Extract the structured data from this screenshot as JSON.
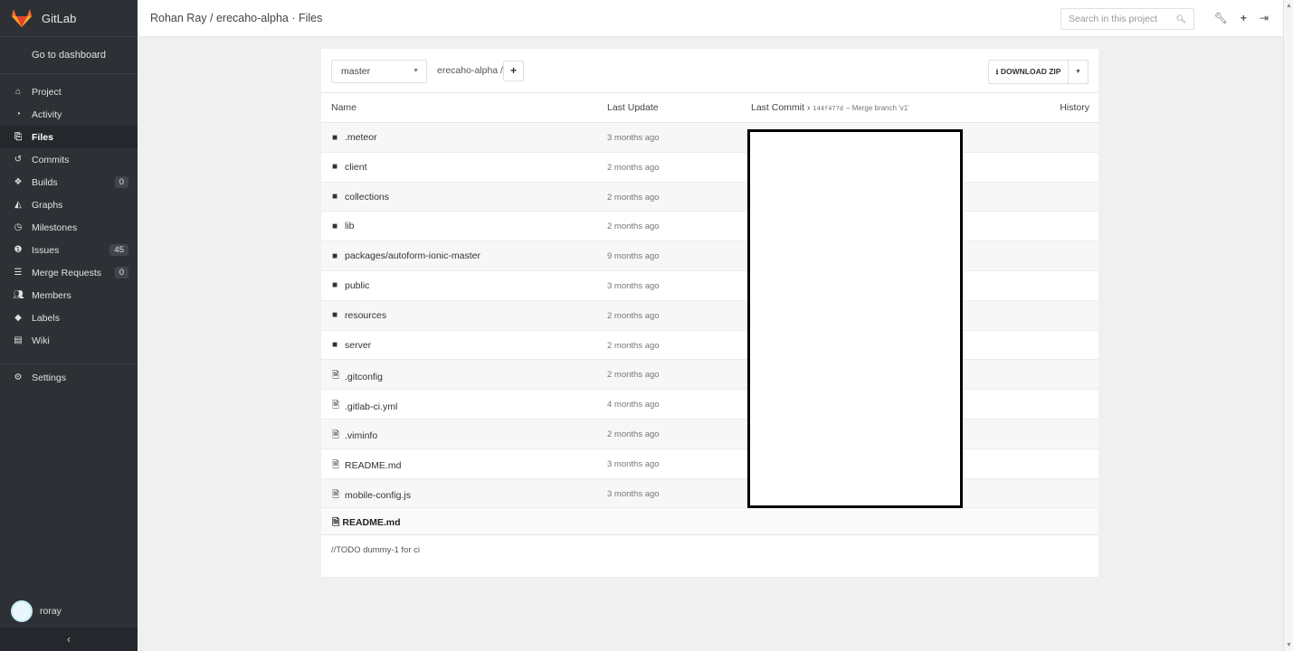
{
  "brand": {
    "title": "GitLab",
    "accent": "#e24329"
  },
  "sidebar": {
    "dashboard": "Go to dashboard",
    "items": [
      {
        "label": "Project",
        "icon": "home-icon"
      },
      {
        "label": "Activity",
        "icon": "tachometer-icon"
      },
      {
        "label": "Files",
        "icon": "files-icon",
        "active": true
      },
      {
        "label": "Commits",
        "icon": "history-icon"
      },
      {
        "label": "Builds",
        "icon": "cubes-icon",
        "count": "0"
      },
      {
        "label": "Graphs",
        "icon": "area-chart-icon"
      },
      {
        "label": "Milestones",
        "icon": "clock-icon"
      },
      {
        "label": "Issues",
        "icon": "exclamation-circle-icon",
        "count": "45"
      },
      {
        "label": "Merge Requests",
        "icon": "tasks-icon",
        "count": "0"
      },
      {
        "label": "Members",
        "icon": "users-icon"
      },
      {
        "label": "Labels",
        "icon": "tags-icon"
      },
      {
        "label": "Wiki",
        "icon": "book-icon"
      },
      {
        "label": "Settings",
        "icon": "cogs-icon"
      }
    ],
    "user": "roray",
    "collapse": "‹"
  },
  "header": {
    "breadcrumb": "Rohan Ray / erecaho-alpha · Files",
    "search_placeholder": "Search in this project"
  },
  "toolbar": {
    "branch": "master",
    "path": "erecaho-alpha /",
    "add": "+",
    "download": "DOWNLOAD ZIP"
  },
  "table": {
    "headers": {
      "name": "Name",
      "last_update": "Last Update",
      "last_commit": "Last Commit",
      "history": "History"
    },
    "commit_hash": "144f477d",
    "commit_msg": "– Merge branch 'v1'",
    "rows": [
      {
        "name": ".meteor",
        "type": "folder",
        "date": "3 months ago"
      },
      {
        "name": "client",
        "type": "folder",
        "date": "2 months ago"
      },
      {
        "name": "collections",
        "type": "folder",
        "date": "2 months ago"
      },
      {
        "name": "lib",
        "type": "folder",
        "date": "2 months ago"
      },
      {
        "name": "packages/autoform-ionic-master",
        "type": "folder",
        "date": "9 months ago"
      },
      {
        "name": "public",
        "type": "folder",
        "date": "3 months ago"
      },
      {
        "name": "resources",
        "type": "folder",
        "date": "2 months ago"
      },
      {
        "name": "server",
        "type": "folder",
        "date": "2 months ago"
      },
      {
        "name": ".gitconfig",
        "type": "file",
        "date": "2 months ago"
      },
      {
        "name": ".gitlab-ci.yml",
        "type": "file",
        "date": "4 months ago"
      },
      {
        "name": ".viminfo",
        "type": "file",
        "date": "2 months ago"
      },
      {
        "name": "README.md",
        "type": "file",
        "date": "3 months ago"
      },
      {
        "name": "mobile-config.js",
        "type": "file",
        "date": "3 months ago"
      }
    ]
  },
  "readme": {
    "title": "README.md",
    "content": "//TODO dummy-1 for ci"
  }
}
